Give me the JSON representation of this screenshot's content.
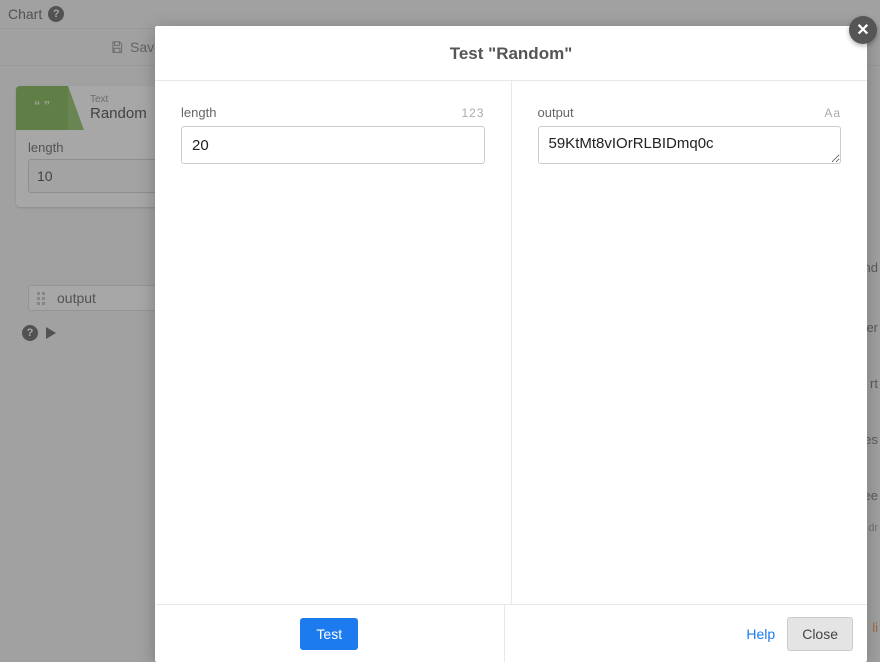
{
  "page": {
    "breadcrumb": "Chart",
    "save_label": "Save",
    "block": {
      "kicker": "Text",
      "title": "Random",
      "field_label": "length",
      "field_value": "10",
      "output_chip": "output"
    },
    "right_fragments": [
      "nd",
      "er",
      "rt",
      "es",
      "ee",
      "r dr",
      "li"
    ]
  },
  "modal": {
    "title": "Test \"Random\"",
    "left": {
      "label": "length",
      "hint": "123",
      "value": "20"
    },
    "right": {
      "label": "output",
      "hint": "Aa",
      "value": "59KtMt8vIOrRLBIDmq0c"
    },
    "buttons": {
      "test": "Test",
      "help": "Help",
      "close": "Close"
    }
  }
}
